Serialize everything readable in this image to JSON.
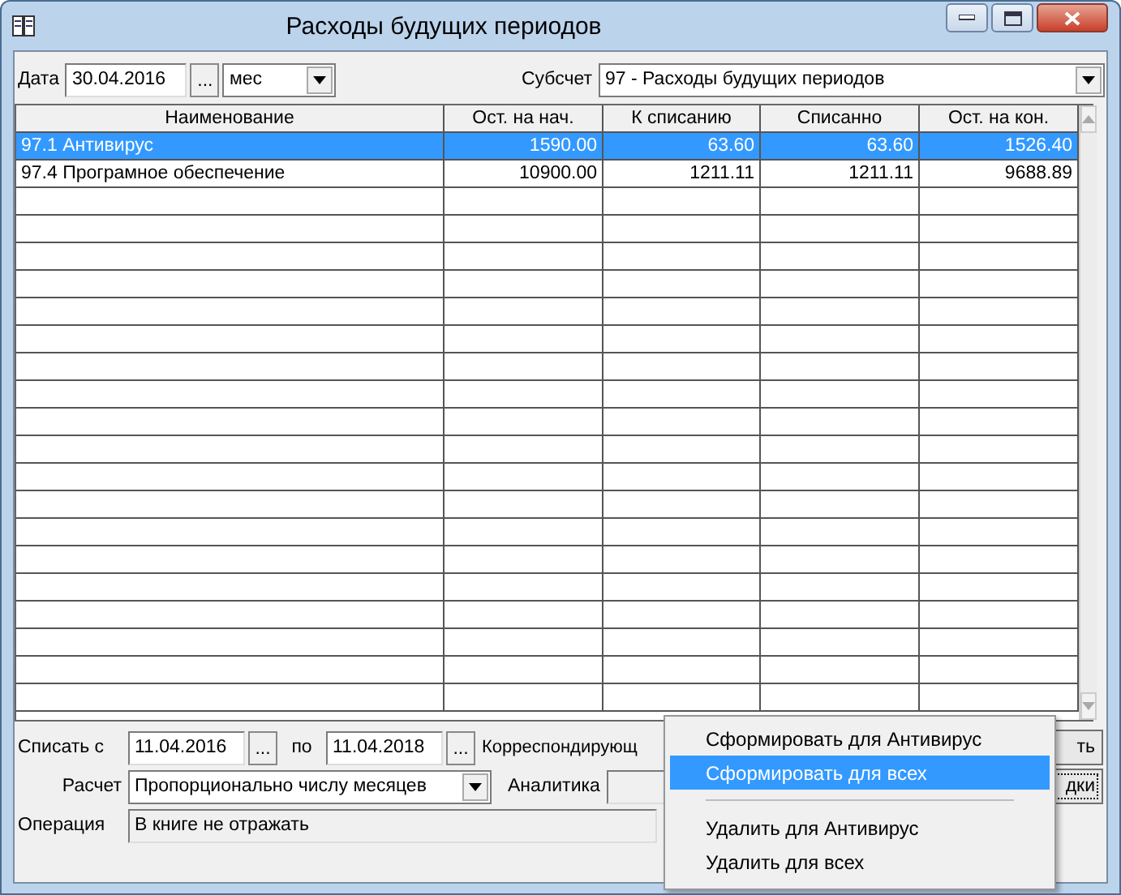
{
  "window": {
    "title": "Расходы будущих периодов"
  },
  "toolbar": {
    "date_label": "Дата",
    "date": "30.04.2016",
    "date_button": "...",
    "period": "мес",
    "subaccount_label": "Субсчет",
    "subaccount": "97 - Расходы будущих периодов"
  },
  "table": {
    "columns": [
      "Наименование",
      "Ост. на нач.",
      "К списанию",
      "Списанно",
      "Ост. на кон."
    ],
    "rows": [
      {
        "selected": true,
        "cells": [
          "97.1  Антивирус",
          "1590.00",
          "63.60",
          "63.60",
          "1526.40"
        ]
      },
      {
        "selected": false,
        "cells": [
          "97.4  Програмное обеспечение",
          "10900.00",
          "1211.11",
          "1211.11",
          "9688.89"
        ]
      }
    ]
  },
  "form": {
    "from_label": "Списать с",
    "from_date": "11.04.2016",
    "from_button": "...",
    "to_label": "по",
    "to_date": "11.04.2018",
    "to_button": "...",
    "corr_label": "Корреспондирующ",
    "button_1": "ть",
    "calc_label": "Расчет",
    "calc": "Пропорционально числу месяцев",
    "analytics_label": "Аналитика",
    "button_2": "дки",
    "operation_label": "Операция",
    "operation": "В книге не отражать"
  },
  "context_menu": {
    "groups": [
      {
        "items": [
          {
            "label": "Сформировать для Антивирус",
            "selected": false
          },
          {
            "label": "Сформировать для всех",
            "selected": true
          }
        ]
      },
      {
        "items": [
          {
            "label": "Удалить для Антивирус",
            "selected": false
          },
          {
            "label": "Удалить для всех",
            "selected": false
          }
        ]
      }
    ]
  }
}
